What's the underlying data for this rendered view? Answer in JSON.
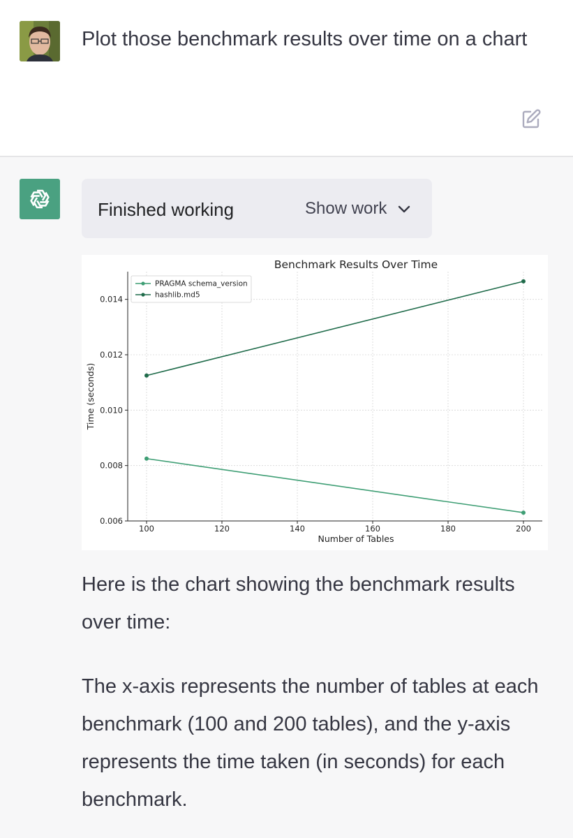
{
  "user_message": {
    "text": "Plot those benchmark results over time on a chart"
  },
  "assistant_message": {
    "work_status": "Finished working",
    "show_work_label": "Show work",
    "paragraphs": [
      "Here is the chart showing the benchmark results over time:",
      "The x-axis represents the number of tables at each benchmark (100 and 200 tables), and the y-axis represents the time taken (in seconds) for each benchmark."
    ]
  },
  "colors": {
    "assistant_bg": "#f7f7f8",
    "gpt_avatar": "#4aa181",
    "series_1": "#3e9e74",
    "series_2": "#1f6b4a"
  },
  "chart_data": {
    "type": "line",
    "title": "Benchmark Results Over Time",
    "xlabel": "Number of Tables",
    "ylabel": "Time (seconds)",
    "xlim": [
      95,
      205
    ],
    "ylim": [
      0.006,
      0.015
    ],
    "xticks": [
      100,
      120,
      140,
      160,
      180,
      200
    ],
    "yticks": [
      0.006,
      0.008,
      0.01,
      0.012,
      0.014
    ],
    "ytick_labels": [
      "0.006",
      "0.008",
      "0.010",
      "0.012",
      "0.014"
    ],
    "grid": true,
    "legend_position": "top-left",
    "series": [
      {
        "name": "PRAGMA schema_version",
        "x": [
          100,
          200
        ],
        "y": [
          0.00825,
          0.0063
        ],
        "color": "#3e9e74"
      },
      {
        "name": "hashlib.md5",
        "x": [
          100,
          200
        ],
        "y": [
          0.01125,
          0.01465
        ],
        "color": "#1f6b4a"
      }
    ]
  }
}
